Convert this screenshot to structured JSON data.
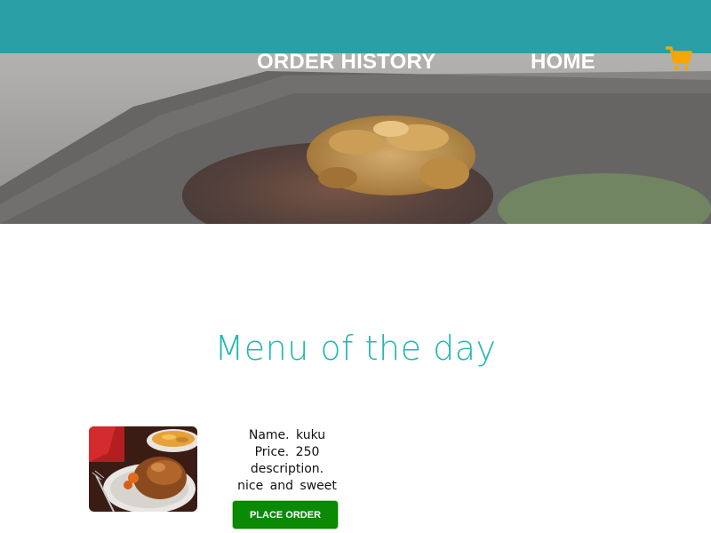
{
  "header": {
    "nav": {
      "order_history": "ORDER HISTORY",
      "home": "HOME"
    },
    "cart_icon": "shopping-cart-icon",
    "accent_color": "#2a9fa6",
    "cart_color": "#f5a600"
  },
  "menu": {
    "title": "Menu of the day",
    "title_color": "#22b8b0",
    "items": [
      {
        "name_line": "Name.  kuku",
        "price_line": "Price.  250",
        "description_label": "description.",
        "description_text": "nice  and  sweet",
        "button_label": "PLACE ORDER",
        "button_color": "#0a8a05"
      }
    ]
  }
}
